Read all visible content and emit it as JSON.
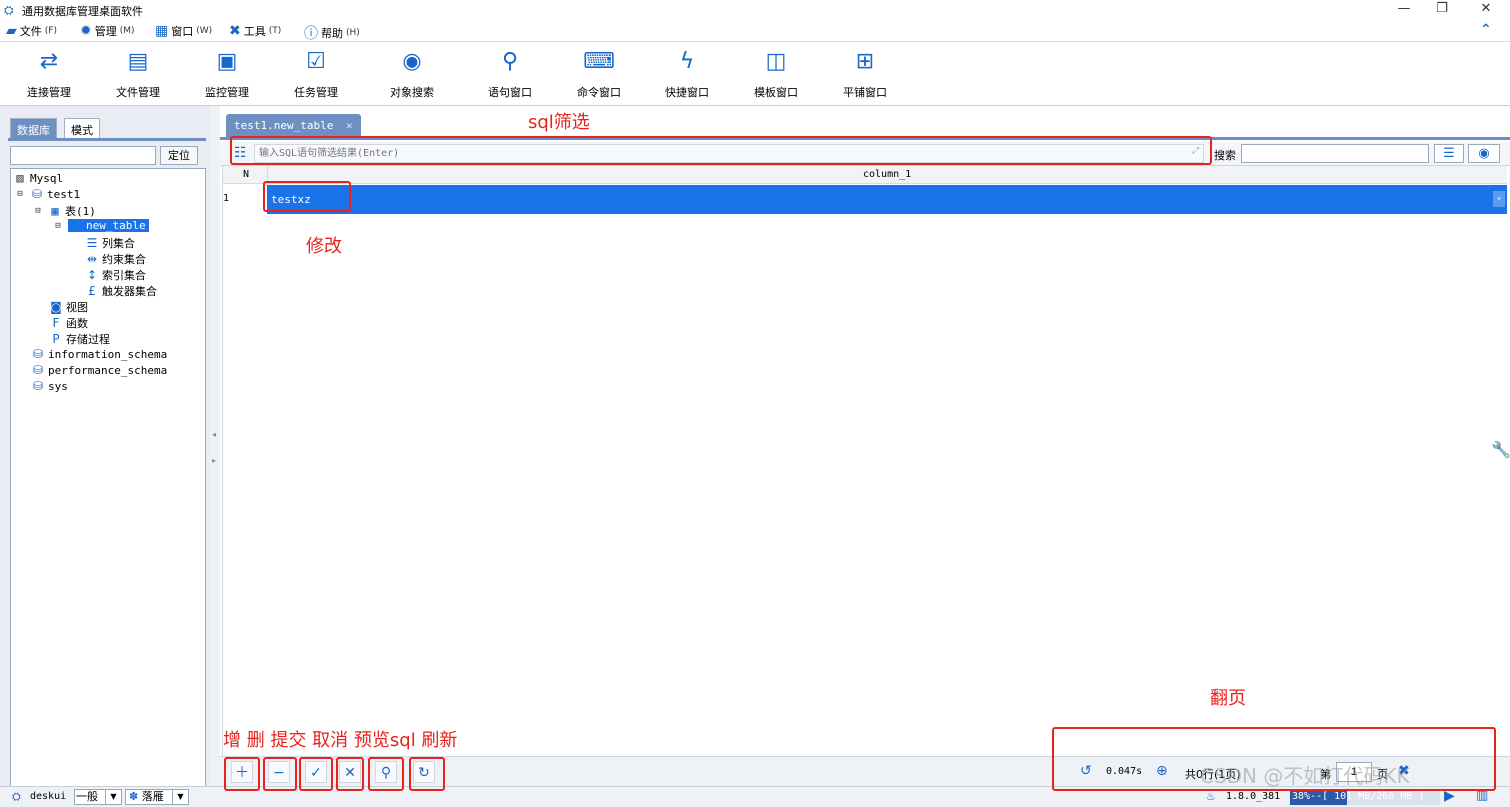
{
  "window": {
    "title": "通用数据库管理桌面软件",
    "minimize": "—",
    "maximize": "❐",
    "close": "✕"
  },
  "menubar": {
    "items": [
      {
        "label": "文件",
        "accel": "(F)"
      },
      {
        "label": "管理",
        "accel": "(M)"
      },
      {
        "label": "窗口",
        "accel": "(W)"
      },
      {
        "label": "工具",
        "accel": "(T)"
      },
      {
        "label": "帮助",
        "accel": "(H)"
      }
    ],
    "collapse": "⌃"
  },
  "toolbar": {
    "items": [
      {
        "label": "连接管理",
        "icon": "refresh-icon"
      },
      {
        "label": "文件管理",
        "icon": "book-icon"
      },
      {
        "label": "监控管理",
        "icon": "monitor-icon"
      },
      {
        "label": "任务管理",
        "icon": "calendar-icon"
      },
      {
        "label": "对象搜索",
        "icon": "object-search-icon"
      },
      {
        "label": "语句窗口",
        "icon": "search-icon"
      },
      {
        "label": "命令窗口",
        "icon": "laptop-icon"
      },
      {
        "label": "快捷窗口",
        "icon": "bolt-icon"
      },
      {
        "label": "模板窗口",
        "icon": "columns-icon"
      },
      {
        "label": "平铺窗口",
        "icon": "grid-icon"
      }
    ]
  },
  "leftpanel": {
    "tabs": [
      "数据库",
      "模式"
    ],
    "locate_button": "定位",
    "search_value": "",
    "tree": {
      "root": "Mysql",
      "db1": "test1",
      "tables": "表(1)",
      "table": "new_table",
      "columns": "列集合",
      "constraints": "约束集合",
      "indexes": "索引集合",
      "triggers": "触发器集合",
      "views": "视图",
      "functions": "函数",
      "procedures": "存储过程",
      "db2": "information_schema",
      "db3": "performance_schema",
      "db4": "sys"
    }
  },
  "editor": {
    "tab_label": "test1.new_table",
    "filter_placeholder": "输入SQL语句筛选结果(Enter)",
    "search_label": "搜索",
    "search_value": "",
    "grid": {
      "columns": [
        "N",
        "column_1"
      ],
      "rows": [
        {
          "n": "1",
          "value": "testxz"
        }
      ]
    },
    "bottom": {
      "elapsed": "0.047s",
      "total": "共0行(1页)",
      "page_prefix": "第",
      "page_value": "1",
      "page_suffix": "页"
    }
  },
  "statusbar": {
    "user": "deskui",
    "mode": "一般",
    "theme": "落雁",
    "version": "1.8.0_381",
    "memory": "38%--[ 101 MB/266 MB ]"
  },
  "annotations": {
    "sql_filter": "sql筛选",
    "modify": "修改",
    "buttons": "增 删 提交 取消 预览sql 刷新",
    "paging": "翻页"
  },
  "watermark": "CSDN @不如打代码KK"
}
